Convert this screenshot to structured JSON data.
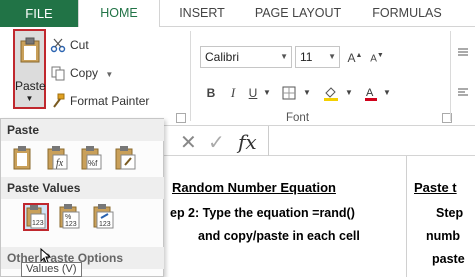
{
  "tabs": {
    "file": "FILE",
    "home": "HOME",
    "insert": "INSERT",
    "page_layout": "PAGE LAYOUT",
    "formulas": "FORMULAS"
  },
  "clipboard": {
    "paste": "Paste",
    "cut": "Cut",
    "copy": "Copy",
    "format_painter": "Format Painter"
  },
  "font": {
    "name": "Calibri",
    "size": "11",
    "group_label": "Font",
    "bold": "B",
    "italic": "I",
    "underline": "U"
  },
  "paste_menu": {
    "paste_header": "Paste",
    "values_header": "Paste Values",
    "other_header": "Other Paste Options",
    "tooltip": "Values (V)"
  },
  "formula_bar": {
    "fx": "fx"
  },
  "sheet": {
    "title_left": "Random Number Equation",
    "title_right": "Paste t",
    "line1_left": "ep 2:  Type the equation =rand()",
    "line2_left": "and copy/paste in each cell",
    "line1_right": "Step",
    "line2_right": "numb",
    "line3_right": "paste"
  },
  "colors": {
    "excel_green": "#217346",
    "highlight_red": "#c0282e"
  }
}
